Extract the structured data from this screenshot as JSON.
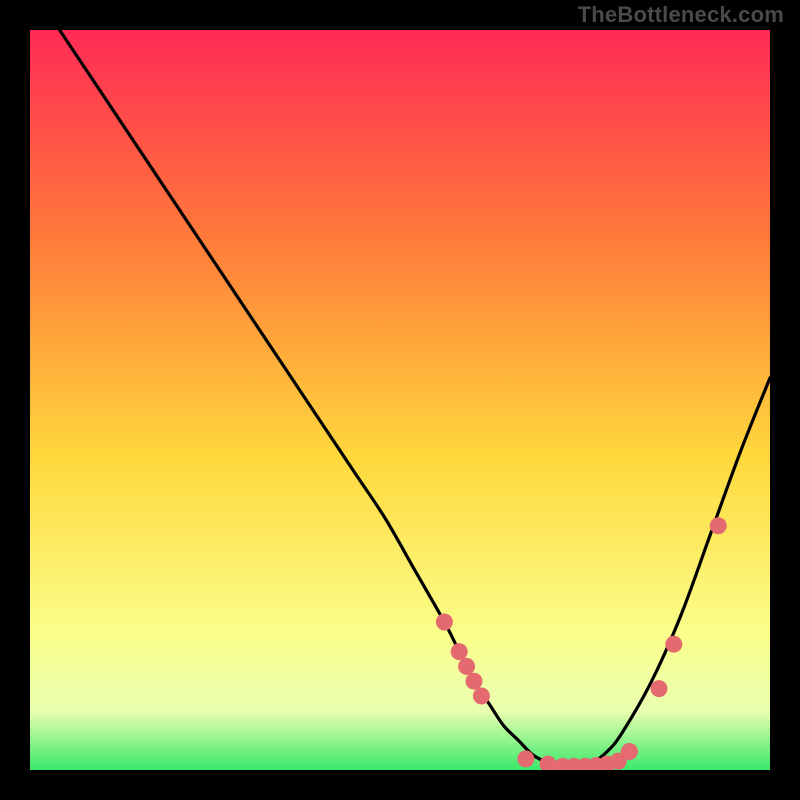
{
  "watermark": "TheBottleneck.com",
  "colors": {
    "frame_bg": "#000000",
    "watermark_text": "#4a4a4a",
    "gradient_top": "#ff2a55",
    "gradient_mid1": "#ff7a3a",
    "gradient_mid2": "#ffd93c",
    "gradient_low1": "#faff8c",
    "gradient_low2": "#e9ffb0",
    "gradient_bottom": "#39e96b",
    "curve": "#000000",
    "marker_fill": "#e46a6f",
    "marker_stroke": "#d85c61"
  },
  "chart_data": {
    "type": "line",
    "title": "",
    "xlabel": "",
    "ylabel": "",
    "xlim": [
      0,
      100
    ],
    "ylim": [
      0,
      100
    ],
    "series": [
      {
        "name": "curve",
        "x": [
          4,
          8,
          12,
          16,
          20,
          24,
          28,
          32,
          36,
          40,
          44,
          48,
          52,
          56,
          58,
          60,
          62,
          64,
          66,
          68,
          70,
          72,
          74,
          76,
          78,
          80,
          84,
          88,
          92,
          96,
          100
        ],
        "y": [
          100,
          94,
          88,
          82,
          76,
          70,
          64,
          58,
          52,
          46,
          40,
          34,
          27,
          20,
          16,
          12,
          9,
          6,
          4,
          2,
          1,
          0.5,
          0.5,
          1,
          2.5,
          5,
          12,
          21,
          32,
          43,
          53
        ]
      }
    ],
    "markers": [
      {
        "x": 56,
        "y": 20
      },
      {
        "x": 58,
        "y": 16
      },
      {
        "x": 59,
        "y": 14
      },
      {
        "x": 60,
        "y": 12
      },
      {
        "x": 61,
        "y": 10
      },
      {
        "x": 67,
        "y": 1.5
      },
      {
        "x": 70,
        "y": 0.8
      },
      {
        "x": 72,
        "y": 0.5
      },
      {
        "x": 73.5,
        "y": 0.5
      },
      {
        "x": 75,
        "y": 0.5
      },
      {
        "x": 76.5,
        "y": 0.6
      },
      {
        "x": 78,
        "y": 0.8
      },
      {
        "x": 79.5,
        "y": 1.2
      },
      {
        "x": 81,
        "y": 2.5
      },
      {
        "x": 85,
        "y": 11
      },
      {
        "x": 87,
        "y": 17
      },
      {
        "x": 93,
        "y": 33
      }
    ]
  }
}
